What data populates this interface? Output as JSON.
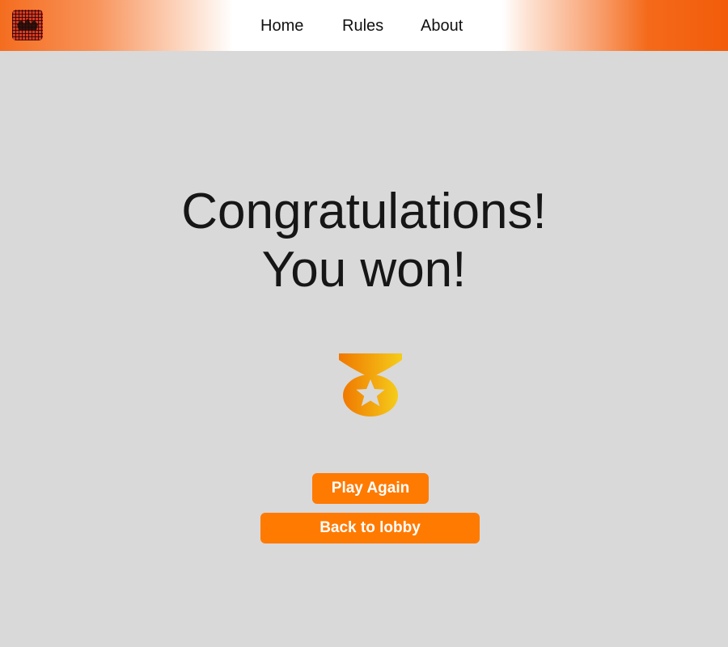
{
  "header": {
    "logo_icon": "game-logo-icon",
    "nav": {
      "home": "Home",
      "rules": "Rules",
      "about": "About"
    }
  },
  "main": {
    "headline_line1": "Congratulations!",
    "headline_line2": "You won!",
    "medal_icon": "medal-star-icon",
    "play_again_label": "Play Again",
    "back_to_lobby_label": "Back to lobby"
  },
  "colors": {
    "background": "#d9d9d9",
    "header_accent": "#f25c0a",
    "button": "#ff7a00",
    "medal_start": "#f07800",
    "medal_end": "#f5cc1a"
  }
}
